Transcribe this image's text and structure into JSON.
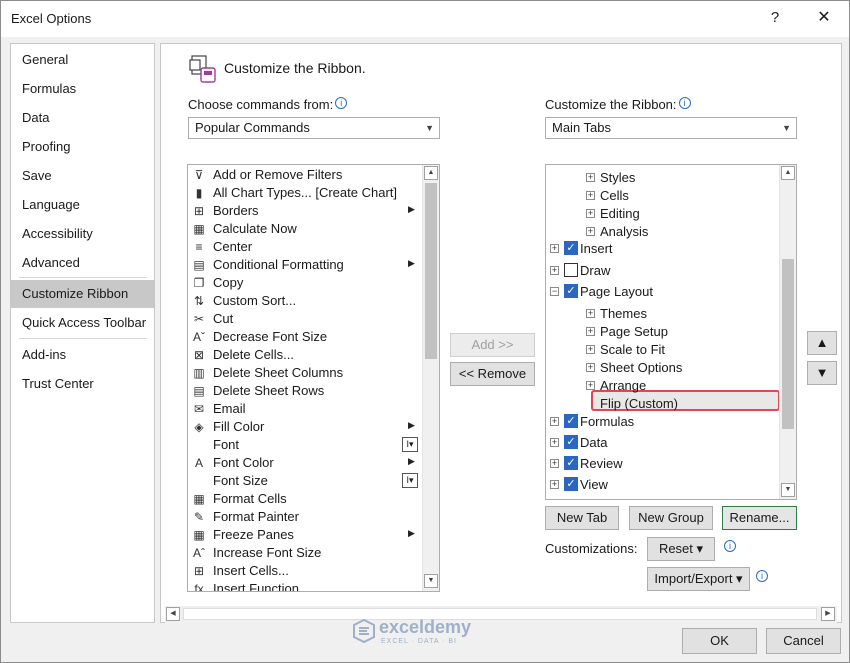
{
  "window": {
    "title": "Excel Options",
    "help": "?",
    "close": "✕"
  },
  "nav": {
    "items": [
      "General",
      "Formulas",
      "Data",
      "Proofing",
      "Save",
      "Language",
      "Accessibility",
      "Advanced",
      "Customize Ribbon",
      "Quick Access Toolbar",
      "Add-ins",
      "Trust Center"
    ],
    "selected": "Customize Ribbon"
  },
  "header": {
    "title": "Customize the Ribbon."
  },
  "left": {
    "label": "Choose commands from:",
    "combo_value": "Popular Commands",
    "commands": [
      {
        "label": "Add or Remove Filters",
        "icon": "filter-icon"
      },
      {
        "label": "All Chart Types... [Create Chart]",
        "icon": "chart-icon"
      },
      {
        "label": "Borders",
        "icon": "borders-icon",
        "submenu": true
      },
      {
        "label": "Calculate Now",
        "icon": "calculator-icon"
      },
      {
        "label": "Center",
        "icon": "center-align-icon"
      },
      {
        "label": "Conditional Formatting",
        "icon": "conditional-formatting-icon",
        "submenu": true
      },
      {
        "label": "Copy",
        "icon": "copy-icon"
      },
      {
        "label": "Custom Sort...",
        "icon": "sort-icon"
      },
      {
        "label": "Cut",
        "icon": "scissors-icon"
      },
      {
        "label": "Decrease Font Size",
        "icon": "decrease-font-icon"
      },
      {
        "label": "Delete Cells...",
        "icon": "delete-cells-icon"
      },
      {
        "label": "Delete Sheet Columns",
        "icon": "delete-columns-icon"
      },
      {
        "label": "Delete Sheet Rows",
        "icon": "delete-rows-icon"
      },
      {
        "label": "Email",
        "icon": "email-icon"
      },
      {
        "label": "Fill Color",
        "icon": "fill-color-icon",
        "submenu": true
      },
      {
        "label": "Font",
        "icon": "font-icon",
        "control": true
      },
      {
        "label": "Font Color",
        "icon": "font-color-icon",
        "submenu": true
      },
      {
        "label": "Font Size",
        "icon": "font-size-icon",
        "control": true
      },
      {
        "label": "Format Cells",
        "icon": "format-cells-icon"
      },
      {
        "label": "Format Painter",
        "icon": "format-painter-icon"
      },
      {
        "label": "Freeze Panes",
        "icon": "freeze-panes-icon",
        "submenu": true
      },
      {
        "label": "Increase Font Size",
        "icon": "increase-font-icon"
      },
      {
        "label": "Insert Cells...",
        "icon": "insert-cells-icon"
      },
      {
        "label": "Insert Function...",
        "icon": "function-icon"
      }
    ]
  },
  "right": {
    "label": "Customize the Ribbon:",
    "combo_value": "Main Tabs",
    "tree": [
      {
        "label": "Styles",
        "level": 2,
        "expander": "+"
      },
      {
        "label": "Cells",
        "level": 2,
        "expander": "+"
      },
      {
        "label": "Editing",
        "level": 2,
        "expander": "+"
      },
      {
        "label": "Analysis",
        "level": 2,
        "expander": "+"
      },
      {
        "label": "Insert",
        "level": 1,
        "expander": "+",
        "checked": true
      },
      {
        "label": "Draw",
        "level": 1,
        "expander": "+",
        "checked": false
      },
      {
        "label": "Page Layout",
        "level": 1,
        "expander": "−",
        "checked": true
      },
      {
        "label": "Themes",
        "level": 2,
        "expander": "+"
      },
      {
        "label": "Page Setup",
        "level": 2,
        "expander": "+"
      },
      {
        "label": "Scale to Fit",
        "level": 2,
        "expander": "+"
      },
      {
        "label": "Sheet Options",
        "level": 2,
        "expander": "+"
      },
      {
        "label": "Arrange",
        "level": 2,
        "expander": "+"
      },
      {
        "label": "Flip (Custom)",
        "level": 2,
        "selected": true
      },
      {
        "label": "Formulas",
        "level": 1,
        "expander": "+",
        "checked": true
      },
      {
        "label": "Data",
        "level": 1,
        "expander": "+",
        "checked": true
      },
      {
        "label": "Review",
        "level": 1,
        "expander": "+",
        "checked": true
      },
      {
        "label": "View",
        "level": 1,
        "expander": "+",
        "checked": true
      }
    ]
  },
  "buttons": {
    "add": "Add >>",
    "remove": "<< Remove",
    "new_tab": "New Tab",
    "new_group": "New Group",
    "rename": "Rename...",
    "customizations_label": "Customizations:",
    "reset": "Reset ▾",
    "import_export": "Import/Export ▾",
    "move_up": "▲",
    "move_down": "▼",
    "ok": "OK",
    "cancel": "Cancel"
  },
  "watermark": {
    "name": "exceldemy",
    "tagline": "EXCEL · DATA · BI"
  },
  "colors": {
    "accent": "#2b66c0",
    "highlight_border": "#e04850",
    "selected_nav": "#c8c8c8"
  }
}
